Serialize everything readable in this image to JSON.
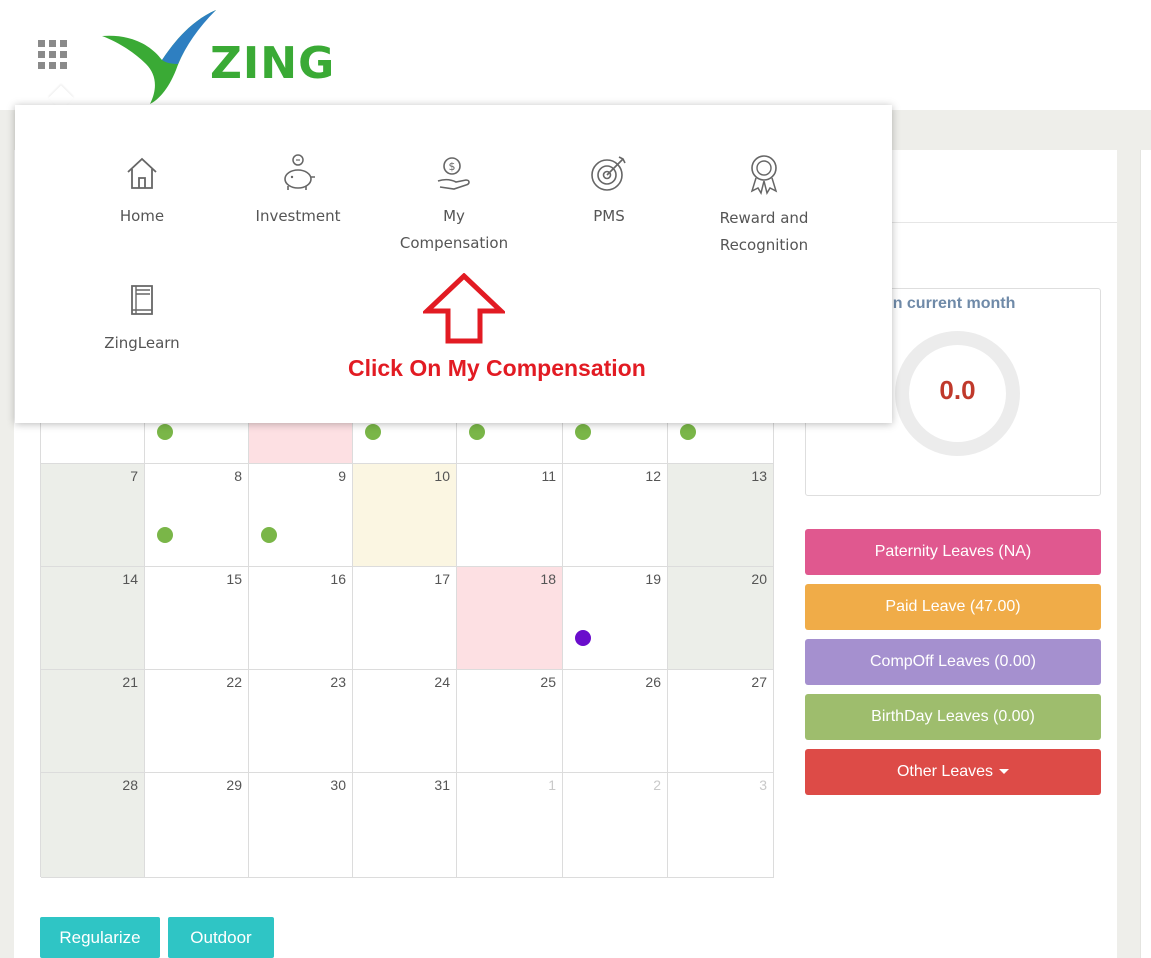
{
  "header": {
    "brand": "ZING"
  },
  "apps_menu": {
    "items": [
      {
        "label": "Home",
        "icon": "home-icon"
      },
      {
        "label": "Investment",
        "icon": "piggy-bank-icon"
      },
      {
        "label": "My\nCompensation",
        "icon": "hand-coin-icon"
      },
      {
        "label": "PMS",
        "icon": "target-icon"
      },
      {
        "label": "Reward and\nRecognition",
        "icon": "award-ribbon-icon"
      },
      {
        "label": "ZingLearn",
        "icon": "book-icon"
      }
    ],
    "instruction": "Click On My Compensation"
  },
  "attendance": {
    "title_visible": "ce in current month",
    "value": "0.0"
  },
  "calendar": {
    "rows": [
      [
        "7",
        "8",
        "9",
        "10",
        "11",
        "12",
        "13"
      ],
      [
        "14",
        "15",
        "16",
        "17",
        "18",
        "19",
        "20"
      ],
      [
        "21",
        "22",
        "23",
        "24",
        "25",
        "26",
        "27"
      ],
      [
        "28",
        "29",
        "30",
        "31",
        "1",
        "2",
        "3"
      ]
    ],
    "muted_dates": [
      "1",
      "2",
      "3"
    ],
    "weekend_columns": [
      0,
      6
    ],
    "holiday_dates": [
      "18"
    ],
    "today_date": "10"
  },
  "leave_buttons": [
    {
      "label": "Paternity Leaves (NA)",
      "color": "#e0588f"
    },
    {
      "label": "Paid Leave (47.00)",
      "color": "#f0ac48"
    },
    {
      "label": "CompOff Leaves (0.00)",
      "color": "#a590cf"
    },
    {
      "label": "BirthDay Leaves (0.00)",
      "color": "#9ebd6d"
    },
    {
      "label": "Other Leaves",
      "color": "#dd4b47",
      "dropdown": true
    }
  ],
  "actions": {
    "regularize": "Regularize",
    "outdoor": "Outdoor"
  },
  "colors": {
    "brand_green": "#3aaa35",
    "present_dot": "#7ab648",
    "leave_dot": "#6a0dcc",
    "action_teal": "#2fc5c5",
    "instruction_red": "#e21b23"
  }
}
